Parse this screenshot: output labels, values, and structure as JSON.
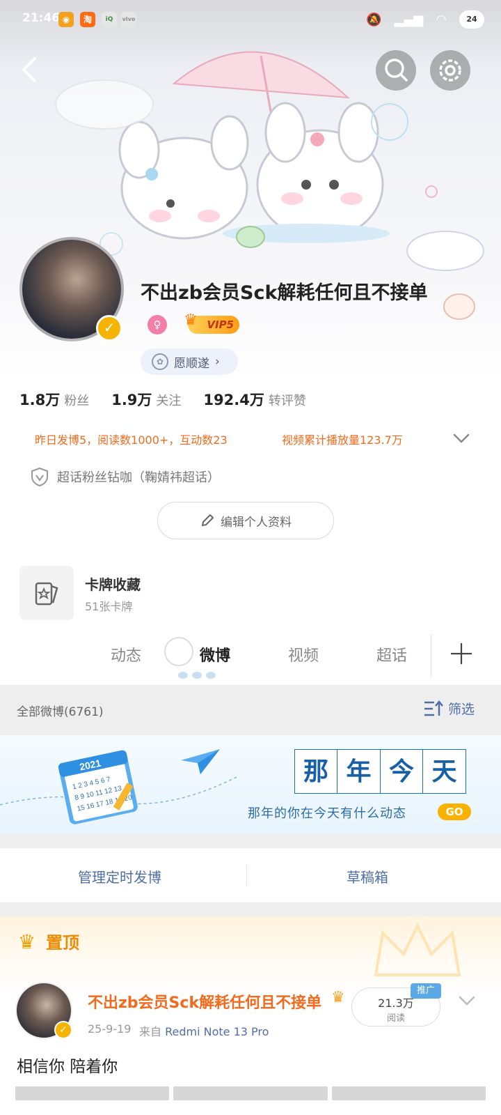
{
  "status_bar": {
    "time": "21:46",
    "battery": "24",
    "apps": [
      "weibo-icon",
      "taobao-icon",
      "iqiyi-icon",
      "vivo-icon"
    ]
  },
  "profile": {
    "name": "不出zb会员Sck解耗任何且不接单",
    "vip_label": "VIP5",
    "tag_label": "愿顺遂",
    "stats": [
      {
        "value": "1.8万",
        "label": "粉丝"
      },
      {
        "value": "1.9万",
        "label": "关注"
      },
      {
        "value": "192.4万",
        "label": "转评赞"
      }
    ],
    "activity": "昨日发博5，阅读数1000+，互动数23",
    "video_stats": "视频累计播放量123.7万",
    "supertopic": "超话粉丝钻咖（鞠婧祎超话）",
    "edit_label": "编辑个人资料"
  },
  "card_collection": {
    "title": "卡牌收藏",
    "subtitle": "51张卡牌"
  },
  "tabs": [
    {
      "label": "动态",
      "active": false
    },
    {
      "label": "微博",
      "active": true
    },
    {
      "label": "视频",
      "active": false
    },
    {
      "label": "超话",
      "active": false
    }
  ],
  "filter": {
    "count_label": "全部微博(6761)",
    "filter_label": "筛选"
  },
  "memory_banner": {
    "chars": [
      "那",
      "年",
      "今",
      "天"
    ],
    "subtitle": "那年的你在今天有什么动态",
    "go_label": "GO",
    "calendar_year": "2021"
  },
  "actions": {
    "scheduled": "管理定时发博",
    "drafts": "草稿箱"
  },
  "pinned_post": {
    "section_label": "置顶",
    "author": "不出zb会员Sck解耗任何且不接单",
    "date": "25-9-19",
    "from_prefix": "来自",
    "device": "Redmi Note 13 Pro",
    "reads": "21.3万",
    "reads_label": "阅读",
    "promo_label": "推广",
    "text": "相信你 陪着你"
  },
  "colors": {
    "orange": "#f36a1c",
    "link_blue": "#4f6ea6",
    "gold": "#f6b400"
  }
}
